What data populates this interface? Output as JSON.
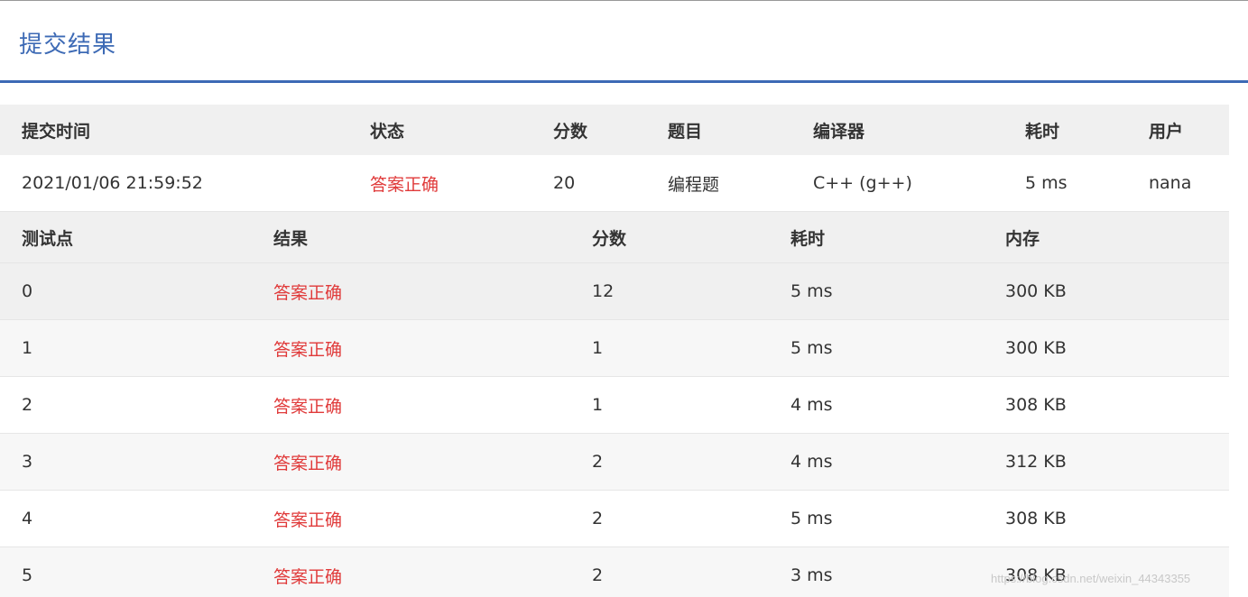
{
  "page": {
    "title": "提交结果",
    "accent_color": "#3d6ab5",
    "correct_color": "#e03a3a"
  },
  "submission": {
    "headers": {
      "time": "提交时间",
      "status": "状态",
      "score": "分数",
      "problem": "题目",
      "compiler": "编译器",
      "duration": "耗时",
      "user": "用户"
    },
    "row": {
      "time": "2021/01/06 21:59:52",
      "status": "答案正确",
      "score": "20",
      "problem": "编程题",
      "compiler": "C++ (g++)",
      "duration": "5 ms",
      "user": "nana"
    }
  },
  "testcases": {
    "headers": {
      "case": "测试点",
      "result": "结果",
      "score": "分数",
      "duration": "耗时",
      "memory": "内存"
    },
    "rows": [
      {
        "case": "0",
        "result": "答案正确",
        "score": "12",
        "duration": "5 ms",
        "memory": "300 KB"
      },
      {
        "case": "1",
        "result": "答案正确",
        "score": "1",
        "duration": "5 ms",
        "memory": "300 KB"
      },
      {
        "case": "2",
        "result": "答案正确",
        "score": "1",
        "duration": "4 ms",
        "memory": "308 KB"
      },
      {
        "case": "3",
        "result": "答案正确",
        "score": "2",
        "duration": "4 ms",
        "memory": "312 KB"
      },
      {
        "case": "4",
        "result": "答案正确",
        "score": "2",
        "duration": "5 ms",
        "memory": "308 KB"
      },
      {
        "case": "5",
        "result": "答案正确",
        "score": "2",
        "duration": "3 ms",
        "memory": "308 KB"
      }
    ]
  },
  "watermark": "https://blog.csdn.net/weixin_44343355"
}
